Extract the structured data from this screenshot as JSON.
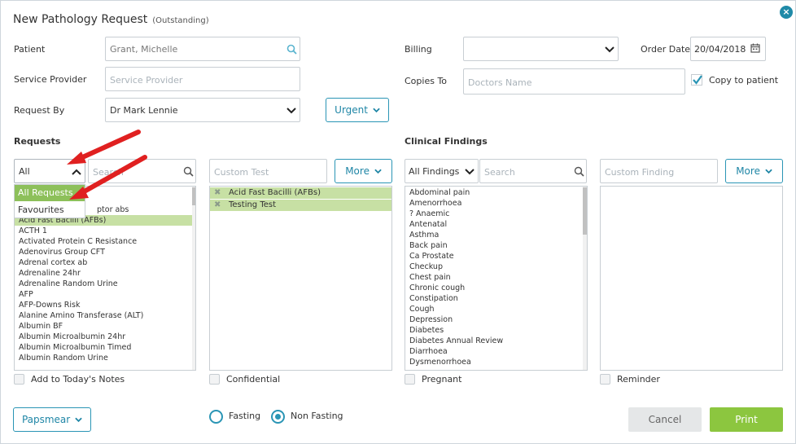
{
  "dialog": {
    "title": "New Pathology Request",
    "status": "(Outstanding)",
    "close_glyph": "×"
  },
  "patient": {
    "label": "Patient",
    "value": "Grant, Michelle",
    "icon": "search-icon"
  },
  "service_provider": {
    "label": "Service Provider",
    "placeholder": "Service Provider"
  },
  "request_by": {
    "label": "Request By",
    "value": "Dr Mark Lennie"
  },
  "urgent_button": {
    "label": "Urgent"
  },
  "billing": {
    "label": "Billing",
    "value": ""
  },
  "order_date": {
    "label": "Order Date",
    "value": "20/04/2018",
    "icon": "calendar-icon"
  },
  "copies_to": {
    "label": "Copies To",
    "placeholder": "Doctors Name"
  },
  "copy_to_patient": {
    "label": "Copy to patient",
    "checked": true
  },
  "requests": {
    "title": "Requests",
    "filter_value": "All",
    "search_placeholder": "Search",
    "filter_options": [
      "All Requests",
      "Favourites"
    ],
    "items": [
      "ptor abs",
      "Acid Fast Bacilli (AFBs)",
      "ACTH 1",
      "Activated Protein C Resistance",
      "Adenovirus Group CFT",
      "Adrenal cortex ab",
      "Adrenaline 24hr",
      "Adrenaline Random Urine",
      "AFP",
      "AFP-Downs Risk",
      "Alanine Amino Transferase (ALT)",
      "Albumin BF",
      "Albumin Microalbumin 24hr",
      "Albumin Microalbumin Timed",
      "Albumin Random Urine"
    ],
    "selected_item": "Acid Fast Bacilli (AFBs)"
  },
  "custom_test": {
    "placeholder": "Custom Test",
    "more_label": "More"
  },
  "selected_tests": [
    "Acid Fast Bacilli (AFBs)",
    "Testing Test"
  ],
  "clinical_findings": {
    "title": "Clinical Findings",
    "filter_value": "All Findings",
    "search_placeholder": "Search",
    "items": [
      "Abdominal pain",
      "Amenorrhoea",
      "? Anaemic",
      "Antenatal",
      "Asthma",
      "Back pain",
      "Ca Prostate",
      "Checkup",
      "Chest pain",
      "Chronic cough",
      "Constipation",
      "Cough",
      "Depression",
      "Diabetes",
      "Diabetes Annual Review",
      "Diarrhoea",
      "Dysmenorrhoea"
    ]
  },
  "custom_finding": {
    "placeholder": "Custom Finding",
    "more_label": "More"
  },
  "checkboxes": {
    "add_to_notes": "Add to Today's Notes",
    "confidential": "Confidential",
    "pregnant": "Pregnant",
    "reminder": "Reminder"
  },
  "papsmear_button": {
    "label": "Papsmear"
  },
  "fasting": {
    "fasting_label": "Fasting",
    "non_fasting_label": "Non Fasting",
    "selected": "Non Fasting"
  },
  "footer": {
    "cancel_label": "Cancel",
    "print_label": "Print"
  },
  "colors": {
    "accent": "#2a95b5",
    "selected_row": "#c7e0a4",
    "dropdown_highlight": "#8dc05a",
    "print_button": "#8cc63f",
    "annotation_arrow": "#e02020"
  }
}
